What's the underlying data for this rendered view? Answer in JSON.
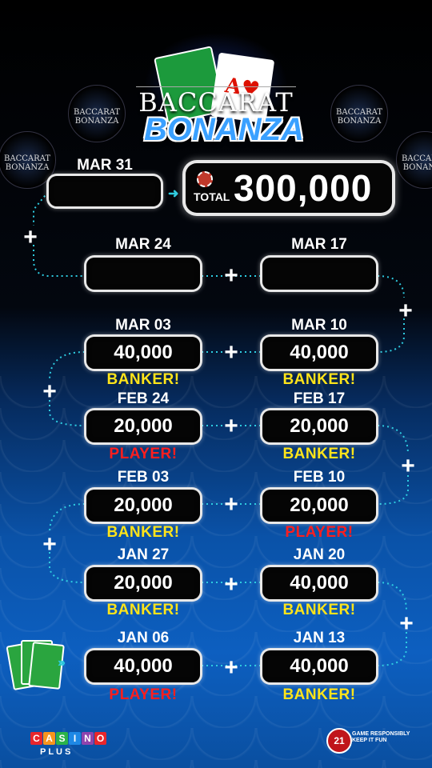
{
  "logo": {
    "line1": "BACCARAT",
    "line2": "BONANZA",
    "mini_text": "BACCARAT BONANZA"
  },
  "total": {
    "label": "TOTAL",
    "value": "300,000"
  },
  "weeks": [
    {
      "date": "MAR 31",
      "amount": "",
      "result": "",
      "result_type": ""
    },
    {
      "date": "MAR 24",
      "amount": "",
      "result": "",
      "result_type": ""
    },
    {
      "date": "MAR 17",
      "amount": "",
      "result": "",
      "result_type": ""
    },
    {
      "date": "MAR 03",
      "amount": "40,000",
      "result": "BANKER!",
      "result_type": "banker"
    },
    {
      "date": "MAR 10",
      "amount": "40,000",
      "result": "BANKER!",
      "result_type": "banker"
    },
    {
      "date": "FEB 24",
      "amount": "20,000",
      "result": "PLAYER!",
      "result_type": "player"
    },
    {
      "date": "FEB 17",
      "amount": "20,000",
      "result": "BANKER!",
      "result_type": "banker"
    },
    {
      "date": "FEB 03",
      "amount": "20,000",
      "result": "BANKER!",
      "result_type": "banker"
    },
    {
      "date": "FEB 10",
      "amount": "20,000",
      "result": "PLAYER!",
      "result_type": "player"
    },
    {
      "date": "JAN 27",
      "amount": "20,000",
      "result": "BANKER!",
      "result_type": "banker"
    },
    {
      "date": "JAN 20",
      "amount": "40,000",
      "result": "BANKER!",
      "result_type": "banker"
    },
    {
      "date": "JAN 06",
      "amount": "40,000",
      "result": "PLAYER!",
      "result_type": "player"
    },
    {
      "date": "JAN 13",
      "amount": "40,000",
      "result": "BANKER!",
      "result_type": "banker"
    }
  ],
  "plus_symbol": "+",
  "footer": {
    "casino_letters": [
      "C",
      "A",
      "S",
      "I",
      "N",
      "O"
    ],
    "casino_colors": [
      "#e8262c",
      "#f7941d",
      "#2bb34a",
      "#1e88e5",
      "#8e44ad",
      "#e8262c"
    ],
    "plus": "PLUS",
    "rg_age": "21",
    "rg_text": "GAME RESPONSIBLY KEEP IT FUN"
  },
  "colors": {
    "banker": "#ffe41a",
    "player": "#ff1e1e",
    "connector": "#2ecbe0"
  }
}
